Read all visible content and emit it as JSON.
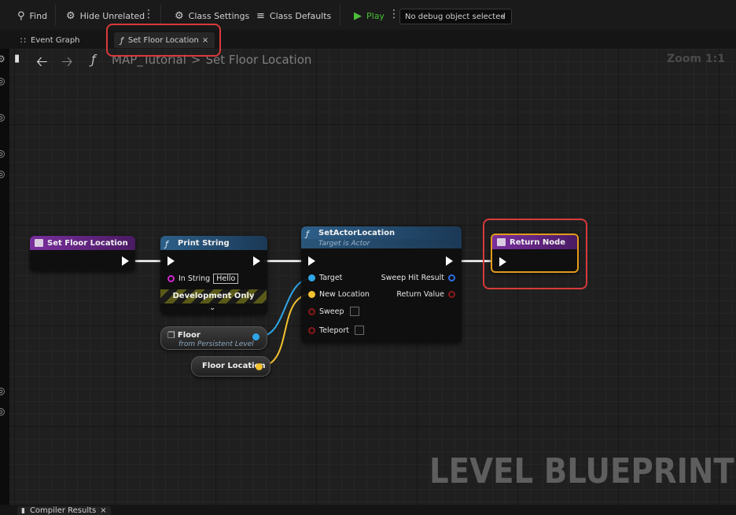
{
  "toolbar": {
    "find": "Find",
    "hide_unrelated": "Hide Unrelated",
    "class_settings": "Class Settings",
    "class_defaults": "Class Defaults",
    "play": "Play",
    "debug_object": "No debug object selected"
  },
  "tabs": [
    {
      "label": "Event Graph"
    },
    {
      "label": "Set Floor Location"
    }
  ],
  "breadcrumb": {
    "root": "MAP_Tutorial",
    "current": "Set Floor Location",
    "separator": ">"
  },
  "zoom": "Zoom 1:1",
  "nodes": {
    "entry": {
      "title": "Set Floor Location"
    },
    "print": {
      "title": "Print String",
      "in_string_label": "In String",
      "in_string_value": "Hello",
      "dev_only": "Development Only"
    },
    "set_actor": {
      "title": "SetActorLocation",
      "subtitle": "Target is Actor",
      "target": "Target",
      "new_location": "New Location",
      "sweep": "Sweep",
      "teleport": "Teleport",
      "sweep_hit": "Sweep Hit Result",
      "return_value": "Return Value"
    },
    "floor": {
      "title": "Floor",
      "subtitle": "from Persistent Level"
    },
    "floor_location": {
      "title": "Floor Location"
    },
    "return": {
      "title": "Return Node"
    }
  },
  "watermark": "LEVEL BLUEPRINT",
  "bottom_tab": "Compiler Results",
  "colors": {
    "highlight": "#d93a3a",
    "exec": "#ffffff",
    "object_pin": "#2fa6e6",
    "vector_pin": "#f2c12e",
    "bool_pin": "#8a1a1a",
    "string_pin": "#d128d1",
    "play": "#4cbf3a"
  }
}
